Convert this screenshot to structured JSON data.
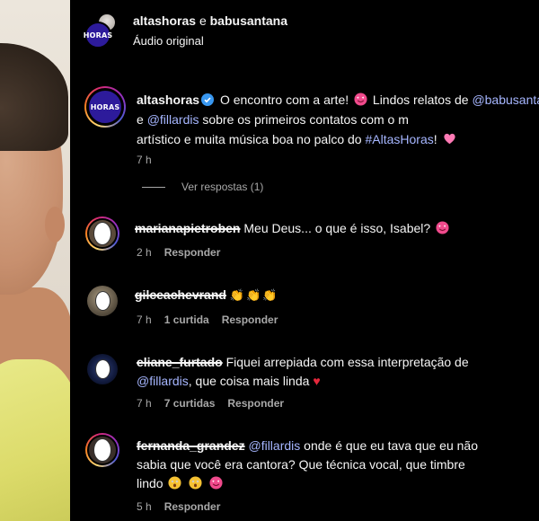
{
  "header": {
    "user1": "altashoras",
    "conjunction": "e",
    "user2": "babusantana",
    "subtitle": "Áudio original",
    "logo_text": "HORAS"
  },
  "caption": {
    "username": "altashoras",
    "text_1": "O encontro com a arte!",
    "text_2": "Lindos relatos de",
    "mention_1": "@babusantana",
    "text_3": "e",
    "mention_2": "@fillardis",
    "text_4": "sobre os primeiros contatos com o m",
    "text_5": "artístico e muita música boa no palco do",
    "hashtag": "#AltasHoras",
    "text_6": "!",
    "time": "7 h",
    "view_replies": "Ver respostas (1)"
  },
  "comments": [
    {
      "username": "marianapietroben",
      "text": "Meu Deus... o que é isso, Isabel?",
      "time": "2 h",
      "likes": "",
      "reply": "Responder"
    },
    {
      "username": "gilceachevrand",
      "text": "",
      "time": "7 h",
      "likes": "1 curtida",
      "reply": "Responder"
    },
    {
      "username": "eliane_furtado",
      "text_1": "Fiquei arrepiada com essa interpretação de",
      "mention": "@fillardis",
      "text_2": ", que coisa mais linda",
      "time": "7 h",
      "likes": "7 curtidas",
      "reply": "Responder"
    },
    {
      "username": "fernanda_grandez",
      "mention": "@fillardis",
      "text_1": "onde é que eu tava que eu não",
      "text_2": "sabia que você era cantora? Que técnica vocal, que timbre",
      "text_3": "lindo",
      "time": "5 h",
      "likes": "",
      "reply": "Responder"
    }
  ],
  "colors": {
    "background": "#000000",
    "text": "#f5f5f5",
    "muted": "#a8a8a8",
    "link": "#a6b6ff",
    "brand": "#2d1b9b",
    "heart": "#e6283c"
  }
}
